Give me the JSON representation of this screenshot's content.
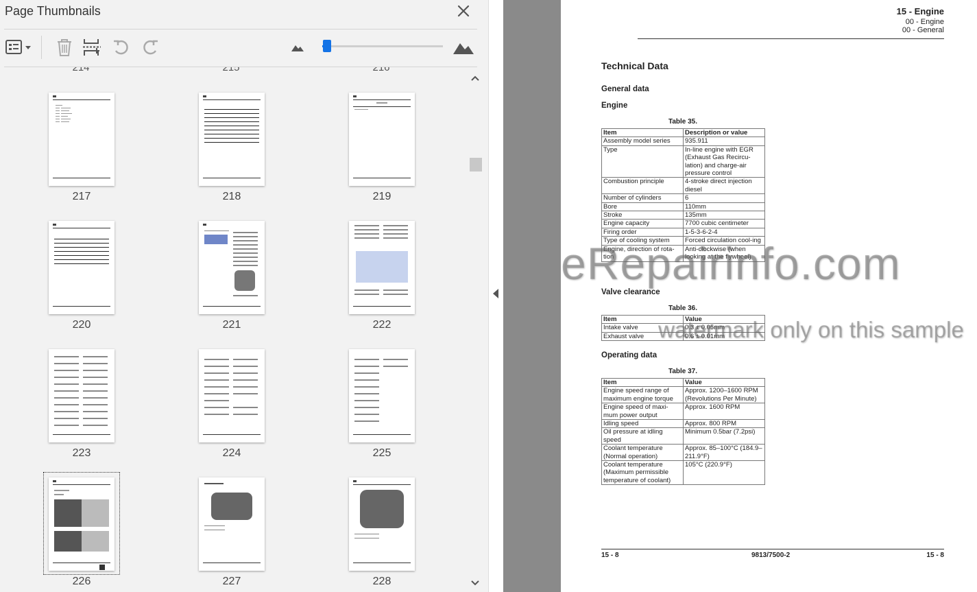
{
  "panel": {
    "title": "Page Thumbnails",
    "toolbar": {
      "options_icon": "list-options-icon",
      "delete_icon": "trash-icon",
      "insert_icon": "insert-pages-icon",
      "undo_icon": "rotate-ccw-icon",
      "redo_icon": "rotate-cw-icon",
      "zoom_out_icon": "mountain-small-icon",
      "zoom_in_icon": "mountain-large-icon",
      "zoom_level": 0.04
    },
    "previous_row_labels": [
      "214",
      "215",
      "216"
    ],
    "thumbnails": [
      {
        "label": "217"
      },
      {
        "label": "218"
      },
      {
        "label": "219"
      },
      {
        "label": "220"
      },
      {
        "label": "221"
      },
      {
        "label": "222"
      },
      {
        "label": "223"
      },
      {
        "label": "224"
      },
      {
        "label": "225"
      },
      {
        "label": "226",
        "selected": true
      },
      {
        "label": "227"
      },
      {
        "label": "228"
      }
    ]
  },
  "document": {
    "header": {
      "main": "15 - Engine",
      "sub1": "00 - Engine",
      "sub2": "00 - General"
    },
    "title": "Technical Data",
    "general_heading": "General data",
    "engine_heading": "Engine",
    "table35": {
      "caption": "Table 35.",
      "headers": [
        "Item",
        "Description or value"
      ],
      "rows": [
        [
          "Assembly model series",
          "935.911"
        ],
        [
          "Type",
          "In-line engine with EGR (Exhaust Gas Recircu-lation) and charge-air pressure control"
        ],
        [
          "Combustion principle",
          "4-stroke direct injection diesel"
        ],
        [
          "Number of cylinders",
          "6"
        ],
        [
          "Bore",
          "110mm"
        ],
        [
          "Stroke",
          "135mm"
        ],
        [
          "Engine capacity",
          "7700 cubic centimeter"
        ],
        [
          "Firing order",
          "1-5-3-6-2-4"
        ],
        [
          "Type of cooling system",
          "Forced circulation cool-ing"
        ],
        [
          "Engine, direction of rota-tion",
          "Anti-clockwise (when looking at the flywheel)"
        ]
      ]
    },
    "valve_heading": "Valve clearance",
    "table36": {
      "caption": "Table 36.",
      "headers": [
        "Item",
        "Value"
      ],
      "rows": [
        [
          "Intake valve",
          "0.3 ± 0.05mm"
        ],
        [
          "Exhaust valve",
          "0.6 ± 0.01mm"
        ]
      ]
    },
    "operating_heading": "Operating data",
    "table37": {
      "caption": "Table 37.",
      "headers": [
        "Item",
        "Value"
      ],
      "rows": [
        [
          "Engine speed range of maximum engine torque",
          "Approx. 1200–1600 RPM (Revolutions Per Minute)"
        ],
        [
          "Engine speed of maxi-mum power output",
          "Approx. 1600 RPM"
        ],
        [
          "Idling speed",
          "Approx. 800 RPM"
        ],
        [
          "Oil pressure at idling speed",
          "Minimum 0.5bar (7.2psi)"
        ],
        [
          "Coolant temperature (Normal operation)",
          "Approx. 85–100°C (184.9–211.9°F)"
        ],
        [
          "Coolant temperature (Maximum permissible temperature of coolant)",
          "105°C (220.9°F)"
        ]
      ]
    },
    "footer": {
      "left": "15 - 8",
      "center": "9813/7500-2",
      "right": "15 - 8"
    }
  },
  "watermark": {
    "line1": "eRepairinfo.com",
    "line2": "watermark only on this sample"
  },
  "colors": {
    "accent": "#1473e6",
    "panel_bg": "#f2f2f2",
    "viewer_bg": "#8a8a8a"
  }
}
